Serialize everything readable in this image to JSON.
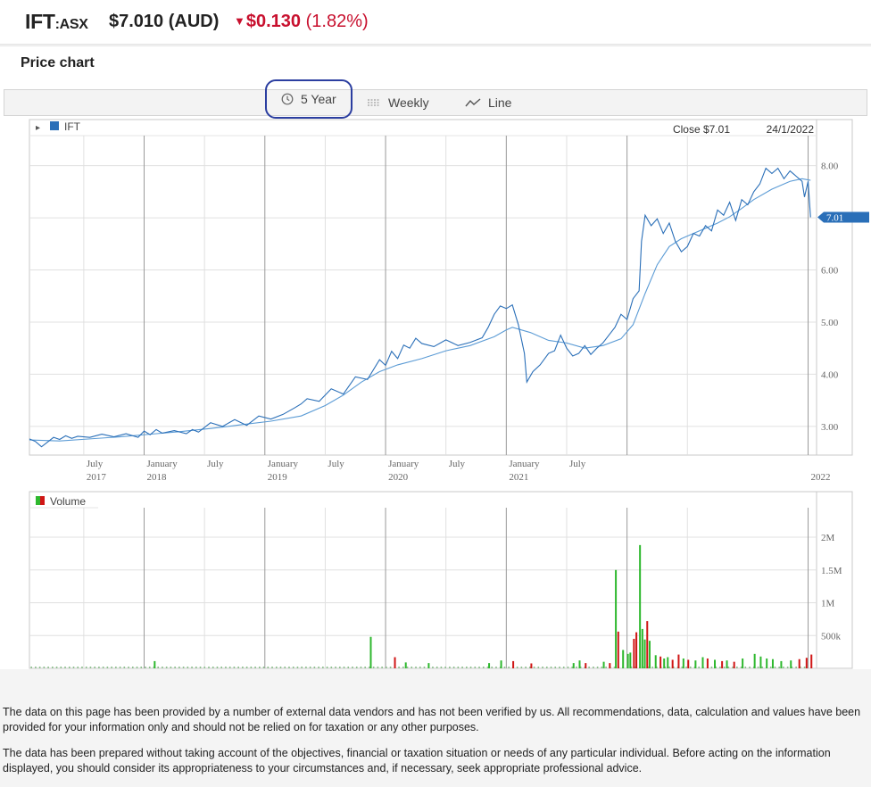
{
  "header": {
    "ticker": "IFT",
    "exchange": ":ASX",
    "price": "$7.010 (AUD)",
    "change_arrow": "▼",
    "change_value": "$0.130",
    "change_percent": "(1.82%)",
    "down_color": "#c8102e"
  },
  "section_title": "Price chart",
  "toolbar": {
    "range_label": "5 Year",
    "interval_label": "Weekly",
    "type_label": "Line",
    "range_icon": "clock-icon",
    "interval_icon": "candles-icon",
    "type_icon": "line-chart-icon"
  },
  "chart_data": [
    {
      "type": "line",
      "series": [
        {
          "name": "IFT",
          "color": "#2a6fb8"
        }
      ],
      "legend_symbol": "▸",
      "close_label": "Close $7.01",
      "date_label": "24/1/2022",
      "last_value_label": "7.01",
      "ylim": [
        2.45,
        8.2
      ],
      "y_ticks": [
        "8.00",
        "7.00",
        "6.00",
        "5.00",
        "4.00",
        "3.00"
      ],
      "x_ticks": [
        {
          "m": "July",
          "y": "2017"
        },
        {
          "m": "January",
          "y": "2018"
        },
        {
          "m": "July",
          "y": ""
        },
        {
          "m": "January",
          "y": "2019"
        },
        {
          "m": "July",
          "y": ""
        },
        {
          "m": "January",
          "y": "2020"
        },
        {
          "m": "July",
          "y": ""
        },
        {
          "m": "January",
          "y": "2021"
        },
        {
          "m": "July",
          "y": ""
        },
        {
          "m": "",
          "y": "2022"
        }
      ],
      "price": [
        [
          2017.05,
          2.76
        ],
        [
          2017.1,
          2.71
        ],
        [
          2017.15,
          2.61
        ],
        [
          2017.2,
          2.7
        ],
        [
          2017.25,
          2.79
        ],
        [
          2017.3,
          2.75
        ],
        [
          2017.35,
          2.82
        ],
        [
          2017.4,
          2.77
        ],
        [
          2017.45,
          2.81
        ],
        [
          2017.55,
          2.79
        ],
        [
          2017.65,
          2.85
        ],
        [
          2017.75,
          2.8
        ],
        [
          2017.85,
          2.86
        ],
        [
          2017.95,
          2.79
        ],
        [
          2018.0,
          2.91
        ],
        [
          2018.05,
          2.84
        ],
        [
          2018.1,
          2.94
        ],
        [
          2018.15,
          2.87
        ],
        [
          2018.25,
          2.92
        ],
        [
          2018.35,
          2.86
        ],
        [
          2018.4,
          2.94
        ],
        [
          2018.45,
          2.89
        ],
        [
          2018.55,
          3.07
        ],
        [
          2018.65,
          3.0
        ],
        [
          2018.75,
          3.13
        ],
        [
          2018.85,
          3.02
        ],
        [
          2018.95,
          3.2
        ],
        [
          2019.05,
          3.14
        ],
        [
          2019.15,
          3.23
        ],
        [
          2019.25,
          3.36
        ],
        [
          2019.3,
          3.43
        ],
        [
          2019.35,
          3.53
        ],
        [
          2019.45,
          3.48
        ],
        [
          2019.55,
          3.72
        ],
        [
          2019.65,
          3.62
        ],
        [
          2019.75,
          3.95
        ],
        [
          2019.85,
          3.9
        ],
        [
          2019.95,
          4.28
        ],
        [
          2020.0,
          4.17
        ],
        [
          2020.05,
          4.44
        ],
        [
          2020.1,
          4.3
        ],
        [
          2020.15,
          4.56
        ],
        [
          2020.2,
          4.5
        ],
        [
          2020.25,
          4.69
        ],
        [
          2020.3,
          4.59
        ],
        [
          2020.4,
          4.53
        ],
        [
          2020.5,
          4.66
        ],
        [
          2020.6,
          4.55
        ],
        [
          2020.7,
          4.61
        ],
        [
          2020.8,
          4.7
        ],
        [
          2020.85,
          4.9
        ],
        [
          2020.9,
          5.15
        ],
        [
          2020.95,
          5.31
        ],
        [
          2021.0,
          5.26
        ],
        [
          2021.05,
          5.33
        ],
        [
          2021.1,
          4.95
        ],
        [
          2021.15,
          4.4
        ],
        [
          2021.17,
          3.85
        ],
        [
          2021.22,
          4.05
        ],
        [
          2021.28,
          4.18
        ],
        [
          2021.35,
          4.4
        ],
        [
          2021.4,
          4.45
        ],
        [
          2021.45,
          4.75
        ],
        [
          2021.5,
          4.5
        ],
        [
          2021.55,
          4.35
        ],
        [
          2021.6,
          4.4
        ],
        [
          2021.65,
          4.55
        ],
        [
          2021.7,
          4.38
        ],
        [
          2021.75,
          4.5
        ],
        [
          2021.8,
          4.6
        ],
        [
          2021.85,
          4.75
        ],
        [
          2021.9,
          4.9
        ],
        [
          2021.95,
          5.15
        ],
        [
          2022.0,
          5.05
        ],
        [
          2022.05,
          5.45
        ],
        [
          2022.1,
          5.6
        ],
        [
          2022.12,
          6.55
        ],
        [
          2022.15,
          7.05
        ],
        [
          2022.2,
          6.85
        ],
        [
          2022.25,
          6.98
        ],
        [
          2022.3,
          6.7
        ],
        [
          2022.35,
          6.9
        ],
        [
          2022.4,
          6.55
        ],
        [
          2022.45,
          6.35
        ],
        [
          2022.5,
          6.45
        ],
        [
          2022.55,
          6.7
        ],
        [
          2022.6,
          6.65
        ],
        [
          2022.65,
          6.85
        ],
        [
          2022.7,
          6.75
        ],
        [
          2022.75,
          7.15
        ],
        [
          2022.8,
          7.05
        ],
        [
          2022.85,
          7.3
        ],
        [
          2022.9,
          6.95
        ],
        [
          2022.95,
          7.35
        ],
        [
          2023.0,
          7.25
        ],
        [
          2023.05,
          7.5
        ],
        [
          2023.1,
          7.65
        ],
        [
          2023.15,
          7.95
        ],
        [
          2023.2,
          7.85
        ],
        [
          2023.25,
          7.95
        ],
        [
          2023.3,
          7.75
        ],
        [
          2023.35,
          7.9
        ],
        [
          2023.4,
          7.8
        ],
        [
          2023.45,
          7.7
        ],
        [
          2023.47,
          7.4
        ],
        [
          2023.5,
          7.7
        ],
        [
          2023.52,
          7.01
        ]
      ],
      "average": [
        [
          2017.05,
          2.74
        ],
        [
          2017.3,
          2.72
        ],
        [
          2017.55,
          2.76
        ],
        [
          2017.8,
          2.8
        ],
        [
          2018.05,
          2.85
        ],
        [
          2018.3,
          2.9
        ],
        [
          2018.55,
          2.96
        ],
        [
          2018.8,
          3.03
        ],
        [
          2019.05,
          3.1
        ],
        [
          2019.3,
          3.2
        ],
        [
          2019.5,
          3.4
        ],
        [
          2019.65,
          3.6
        ],
        [
          2019.8,
          3.85
        ],
        [
          2019.95,
          4.05
        ],
        [
          2020.1,
          4.18
        ],
        [
          2020.3,
          4.3
        ],
        [
          2020.5,
          4.45
        ],
        [
          2020.7,
          4.55
        ],
        [
          2020.9,
          4.72
        ],
        [
          2021.0,
          4.85
        ],
        [
          2021.05,
          4.9
        ],
        [
          2021.2,
          4.8
        ],
        [
          2021.35,
          4.65
        ],
        [
          2021.5,
          4.6
        ],
        [
          2021.65,
          4.5
        ],
        [
          2021.8,
          4.55
        ],
        [
          2021.95,
          4.68
        ],
        [
          2022.05,
          4.95
        ],
        [
          2022.15,
          5.55
        ],
        [
          2022.25,
          6.1
        ],
        [
          2022.35,
          6.45
        ],
        [
          2022.45,
          6.6
        ],
        [
          2022.55,
          6.7
        ],
        [
          2022.65,
          6.8
        ],
        [
          2022.75,
          6.9
        ],
        [
          2022.85,
          7.02
        ],
        [
          2022.95,
          7.18
        ],
        [
          2023.05,
          7.35
        ],
        [
          2023.2,
          7.55
        ],
        [
          2023.35,
          7.7
        ],
        [
          2023.45,
          7.75
        ],
        [
          2023.52,
          7.72
        ]
      ]
    },
    {
      "type": "bar",
      "title": "Volume",
      "up_color": "#2eb82e",
      "down_color": "#d01515",
      "ylim": [
        0,
        2300000
      ],
      "y_ticks": [
        "2M",
        "1.5M",
        "1M",
        "500k"
      ],
      "bars": [
        [
          2018.08,
          110000,
          "up"
        ],
        [
          2019.87,
          480000,
          "up"
        ],
        [
          2020.07,
          170000,
          "down"
        ],
        [
          2020.16,
          90000,
          "up"
        ],
        [
          2020.35,
          80000,
          "up"
        ],
        [
          2020.85,
          80000,
          "up"
        ],
        [
          2020.95,
          120000,
          "up"
        ],
        [
          2021.05,
          110000,
          "down"
        ],
        [
          2021.2,
          75000,
          "down"
        ],
        [
          2021.55,
          80000,
          "up"
        ],
        [
          2021.6,
          120000,
          "up"
        ],
        [
          2021.65,
          80000,
          "down"
        ],
        [
          2021.8,
          100000,
          "up"
        ],
        [
          2021.85,
          80000,
          "down"
        ],
        [
          2021.9,
          1500000,
          "up"
        ],
        [
          2021.92,
          560000,
          "down"
        ],
        [
          2021.96,
          280000,
          "up"
        ],
        [
          2022.0,
          220000,
          "up"
        ],
        [
          2022.02,
          240000,
          "up"
        ],
        [
          2022.05,
          450000,
          "down"
        ],
        [
          2022.07,
          550000,
          "down"
        ],
        [
          2022.1,
          1880000,
          "up"
        ],
        [
          2022.12,
          600000,
          "up"
        ],
        [
          2022.14,
          440000,
          "up"
        ],
        [
          2022.16,
          720000,
          "down"
        ],
        [
          2022.18,
          420000,
          "up"
        ],
        [
          2022.23,
          200000,
          "up"
        ],
        [
          2022.27,
          180000,
          "down"
        ],
        [
          2022.3,
          150000,
          "up"
        ],
        [
          2022.33,
          170000,
          "up"
        ],
        [
          2022.37,
          130000,
          "down"
        ],
        [
          2022.42,
          210000,
          "down"
        ],
        [
          2022.46,
          150000,
          "up"
        ],
        [
          2022.5,
          130000,
          "down"
        ],
        [
          2022.56,
          120000,
          "up"
        ],
        [
          2022.62,
          170000,
          "up"
        ],
        [
          2022.66,
          150000,
          "down"
        ],
        [
          2022.72,
          130000,
          "up"
        ],
        [
          2022.78,
          110000,
          "down"
        ],
        [
          2022.82,
          120000,
          "up"
        ],
        [
          2022.88,
          100000,
          "down"
        ],
        [
          2022.95,
          150000,
          "up"
        ],
        [
          2023.05,
          220000,
          "up"
        ],
        [
          2023.1,
          180000,
          "up"
        ],
        [
          2023.15,
          150000,
          "up"
        ],
        [
          2023.2,
          140000,
          "up"
        ],
        [
          2023.27,
          110000,
          "up"
        ],
        [
          2023.35,
          120000,
          "up"
        ],
        [
          2023.42,
          140000,
          "down"
        ],
        [
          2023.48,
          160000,
          "down"
        ],
        [
          2023.52,
          210000,
          "down"
        ]
      ]
    }
  ],
  "disclaimer": {
    "p1": "The data on this page has been provided by a number of external data vendors and has not been verified by us. All recommendations, data, calculation and values have been provided for your information only and should not be relied on for taxation or any other purposes.",
    "p2": "The data has been prepared without taking account of the objectives, financial or taxation situation or needs of any particular individual. Before acting on the information displayed, you should consider its appropriateness to your circumstances and, if necessary, seek appropriate professional advice."
  }
}
